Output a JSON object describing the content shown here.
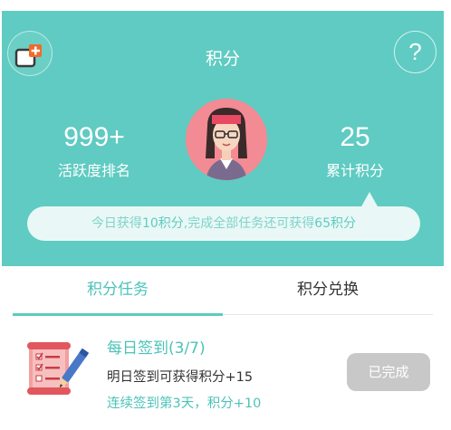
{
  "header": {
    "title": "积分",
    "help_label": "?",
    "stats": {
      "rank_value": "999+",
      "rank_label": "活跃度排名",
      "points_value": "25",
      "points_label": "累计积分"
    },
    "tip": {
      "prefix": "今日获得",
      "earned": "10积分",
      "middle": ",完成全部任务还可获得",
      "remaining": "65积分"
    }
  },
  "tabs": [
    {
      "label": "积分任务",
      "active": true
    },
    {
      "label": "积分兑换",
      "active": false
    }
  ],
  "task": {
    "title": "每日签到(3/7)",
    "description": "明日签到可获得积分+15",
    "streak": "连续签到第3天，积分+10",
    "button_label": "已完成"
  },
  "colors": {
    "primary": "#5fcbc2",
    "accent_text": "#4cc3b9",
    "button_disabled": "#c8c8c8",
    "logo_orange": "#f06a2a"
  },
  "icons": {
    "logo": "app-logo-icon",
    "help": "question-icon",
    "avatar": "user-avatar",
    "task": "checklist-pen-icon"
  }
}
